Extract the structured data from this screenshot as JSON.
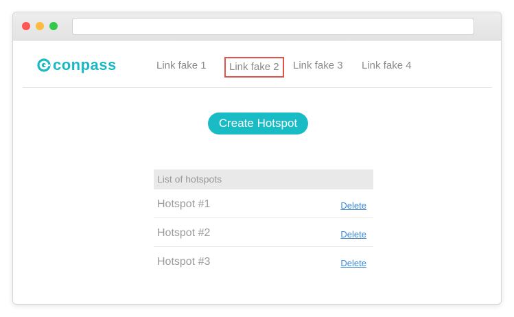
{
  "window": {
    "controls": [
      "close",
      "minimize",
      "maximize"
    ],
    "address": ""
  },
  "brand": {
    "name": "conpass",
    "color": "#19b8c4",
    "icon": "conpass-logo-icon"
  },
  "nav": {
    "links": [
      {
        "label": "Link fake 1",
        "highlighted": false
      },
      {
        "label": "Link fake 2",
        "highlighted": true
      },
      {
        "label": "Link fake 3",
        "highlighted": false
      },
      {
        "label": "Link fake 4",
        "highlighted": false
      }
    ],
    "highlight_color": "#e0534b"
  },
  "main": {
    "create_button": "Create Hotspot",
    "list_title": "List of hotspots",
    "hotspots": [
      {
        "name": "Hotspot #1",
        "action": "Delete"
      },
      {
        "name": "Hotspot #2",
        "action": "Delete"
      },
      {
        "name": "Hotspot #3",
        "action": "Delete"
      }
    ]
  }
}
